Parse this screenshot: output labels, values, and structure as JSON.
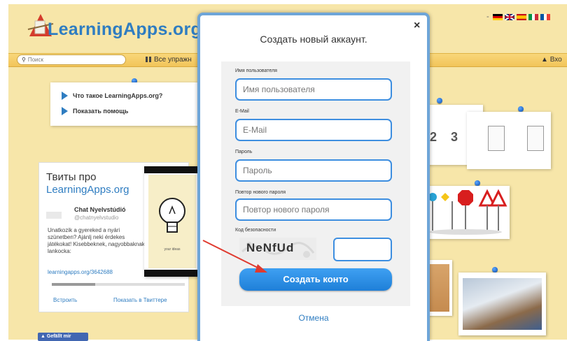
{
  "header": {
    "logo_text": "LearningApps.org",
    "login_label": "Вхо",
    "languages": [
      "de",
      "en",
      "es",
      "it",
      "fr"
    ]
  },
  "nav": {
    "search_placeholder": "Поиск",
    "all_exercises_label": "Все упражн"
  },
  "info_note": {
    "items": [
      "Что такое LearningApps.org?",
      "Показать помощь"
    ]
  },
  "tweets": {
    "title_line1": "Твиты про",
    "title_line2": "LearningApps.org",
    "author_name": "Chat Nyelvstúdió",
    "author_handle": "@chatnyelvstudio",
    "text": "Unatkozik a gyereked a nyári szünetben? Ajánlj neki érdekes játékokat! Kisebbeknek, nagyobbaknak lankocka:",
    "link": "learningapps.org/3642688",
    "embed_label": "Встроить",
    "show_label": "Показать в Твиттере"
  },
  "cards": {
    "numbers": [
      "2",
      "3"
    ],
    "bulb_caption": "your ideas"
  },
  "facebook": {
    "like_label": "Gefällt mir"
  },
  "modal": {
    "title": "Создать новый аккаунт.",
    "close_symbol": "×",
    "username_label": "Имя пользователя",
    "username_placeholder": "Имя пользователя",
    "email_label": "E-Mail",
    "email_placeholder": "E-Mail",
    "password_label": "Пароль",
    "password_placeholder": "Пароль",
    "password_repeat_label": "Повтор нового пароля",
    "password_repeat_placeholder": "Повтор нового пароля",
    "captcha_label": "Код безопасности",
    "captcha_text": "NeNfUd",
    "submit_label": "Создать конто",
    "cancel_label": "Отмена"
  },
  "colors": {
    "accent": "#2f7dc1",
    "background": "#f7e6a9",
    "input_border": "#3d8ee0",
    "arrow": "#e03a2f"
  }
}
